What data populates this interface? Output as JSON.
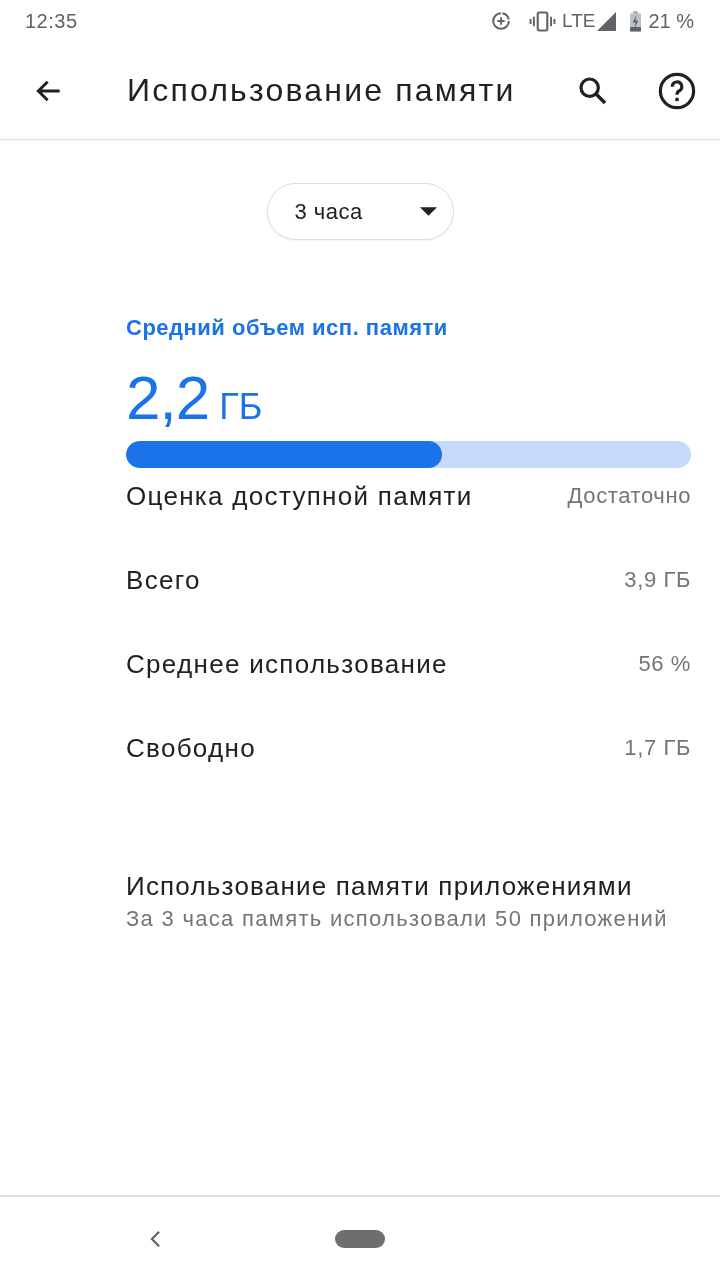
{
  "status_bar": {
    "time": "12:35",
    "network": "LTE",
    "battery": "21 %"
  },
  "app_bar": {
    "title": "Использование памяти"
  },
  "period_dropdown": {
    "value": "3 часа"
  },
  "summary": {
    "label": "Средний объем исп. памяти",
    "value": "2,2",
    "unit": "ГБ",
    "level": 0.56
  },
  "stats": [
    {
      "label": "Оценка доступной памяти",
      "value": "Достаточно"
    },
    {
      "label": "Всего",
      "value": "3,9 ГБ"
    },
    {
      "label": "Среднее использование",
      "value": "56 %"
    },
    {
      "label": "Свободно",
      "value": "1,7 ГБ"
    }
  ],
  "app_usage": {
    "title": "Использование памяти приложениями",
    "subtitle": "За 3 часа память использовали 50 приложений"
  }
}
